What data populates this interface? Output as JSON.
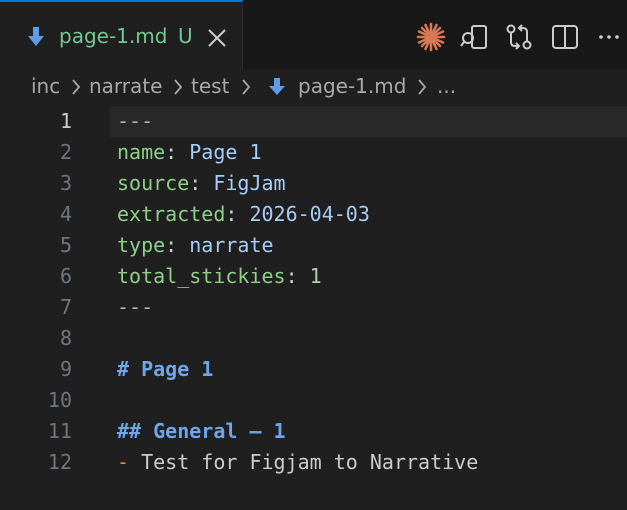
{
  "tab": {
    "label": "page-1.md",
    "badge": "U",
    "icon": "markdown-download-icon",
    "label_color": "#73c991",
    "accent": "#0078d4"
  },
  "actions": [
    {
      "name": "claude-icon",
      "color": "#d97757"
    },
    {
      "name": "open-preview-icon"
    },
    {
      "name": "compare-changes-icon"
    },
    {
      "name": "split-editor-icon"
    },
    {
      "name": "more-actions-icon"
    }
  ],
  "breadcrumb": {
    "items": [
      "inc",
      "narrate",
      "test",
      "page-1.md",
      "..."
    ]
  },
  "editor": {
    "active_line": 1,
    "lines": [
      {
        "n": "1",
        "tokens": [
          {
            "t": "---",
            "c": "muted"
          }
        ]
      },
      {
        "n": "2",
        "tokens": [
          {
            "t": "name",
            "c": "k"
          },
          {
            "t": ": ",
            "c": "punc"
          },
          {
            "t": "Page 1",
            "c": "v"
          }
        ]
      },
      {
        "n": "3",
        "tokens": [
          {
            "t": "source",
            "c": "k"
          },
          {
            "t": ": ",
            "c": "punc"
          },
          {
            "t": "FigJam",
            "c": "v"
          }
        ]
      },
      {
        "n": "4",
        "tokens": [
          {
            "t": "extracted",
            "c": "k"
          },
          {
            "t": ": ",
            "c": "punc"
          },
          {
            "t": "2026-04-03",
            "c": "v"
          }
        ]
      },
      {
        "n": "5",
        "tokens": [
          {
            "t": "type",
            "c": "k"
          },
          {
            "t": ": ",
            "c": "punc"
          },
          {
            "t": "narrate",
            "c": "v"
          }
        ]
      },
      {
        "n": "6",
        "tokens": [
          {
            "t": "total_stickies",
            "c": "k"
          },
          {
            "t": ": ",
            "c": "punc"
          },
          {
            "t": "1",
            "c": "num"
          }
        ]
      },
      {
        "n": "7",
        "tokens": [
          {
            "t": "---",
            "c": "muted"
          }
        ]
      },
      {
        "n": "8",
        "tokens": []
      },
      {
        "n": "9",
        "tokens": [
          {
            "t": "# Page 1",
            "c": "h"
          }
        ]
      },
      {
        "n": "10",
        "tokens": []
      },
      {
        "n": "11",
        "tokens": [
          {
            "t": "## General — 1",
            "c": "h"
          }
        ]
      },
      {
        "n": "12",
        "tokens": [
          {
            "t": "-",
            "c": "dash"
          },
          {
            "t": " Test for Figjam to Narrative",
            "c": "plain"
          }
        ]
      }
    ]
  }
}
